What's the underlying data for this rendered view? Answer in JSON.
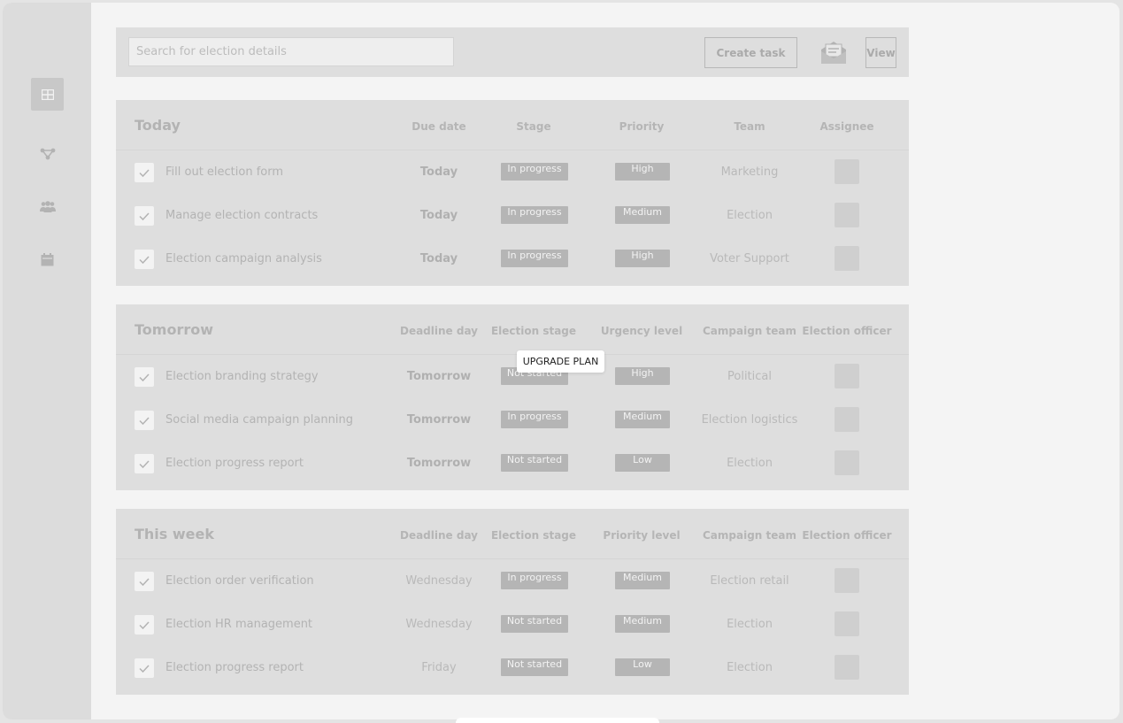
{
  "search": {
    "placeholder": "Search for election details"
  },
  "toolbar": {
    "create_task_label": "Create task",
    "view_label": "View"
  },
  "sidebar": {
    "items": [
      {
        "icon": "grid-icon",
        "active": true
      },
      {
        "icon": "network-icon",
        "active": false
      },
      {
        "icon": "users-icon",
        "active": false
      },
      {
        "icon": "calendar-icon",
        "active": false
      }
    ]
  },
  "sections": [
    {
      "title": "Today",
      "headers": [
        "Due date",
        "Stage",
        "Priority",
        "Team",
        "Assignee"
      ],
      "rows": [
        {
          "task": "Fill out election form",
          "date": "Today",
          "stage": "In progress",
          "priority": "High",
          "team": "Marketing"
        },
        {
          "task": "Manage election contracts",
          "date": "Today",
          "stage": "In progress",
          "priority": "Medium",
          "team": "Election"
        },
        {
          "task": "Election campaign analysis",
          "date": "Today",
          "stage": "In progress",
          "priority": "High",
          "team": "Voter Support"
        }
      ]
    },
    {
      "title": "Tomorrow",
      "headers": [
        "Deadline day",
        "Election stage",
        "Urgency level",
        "Campaign team",
        "Election officer"
      ],
      "rows": [
        {
          "task": "Election branding strategy",
          "date": "Tomorrow",
          "stage": "Not started",
          "priority": "High",
          "team": "Political"
        },
        {
          "task": "Social media campaign planning",
          "date": "Tomorrow",
          "stage": "In progress",
          "priority": "Medium",
          "team": "Election logistics"
        },
        {
          "task": "Election progress report",
          "date": "Tomorrow",
          "stage": "Not started",
          "priority": "Low",
          "team": "Election"
        }
      ]
    },
    {
      "title": "This week",
      "headers": [
        "Deadline day",
        "Election stage",
        "Priority level",
        "Campaign team",
        "Election officer"
      ],
      "rows": [
        {
          "task": "Election order verification",
          "date": "Wednesday",
          "stage": "In progress",
          "priority": "Medium",
          "team": "Election retail"
        },
        {
          "task": "Election HR management",
          "date": "Wednesday",
          "stage": "Not started",
          "priority": "Medium",
          "team": "Election"
        },
        {
          "task": "Election progress report",
          "date": "Friday",
          "stage": "Not started",
          "priority": "Low",
          "team": "Election"
        }
      ]
    }
  ],
  "tooltip": {
    "label": "UPGRADE PLAN"
  },
  "colors": {
    "accent": "#b5b5b5",
    "panel": "#dedede",
    "background": "#f4f4f4"
  }
}
